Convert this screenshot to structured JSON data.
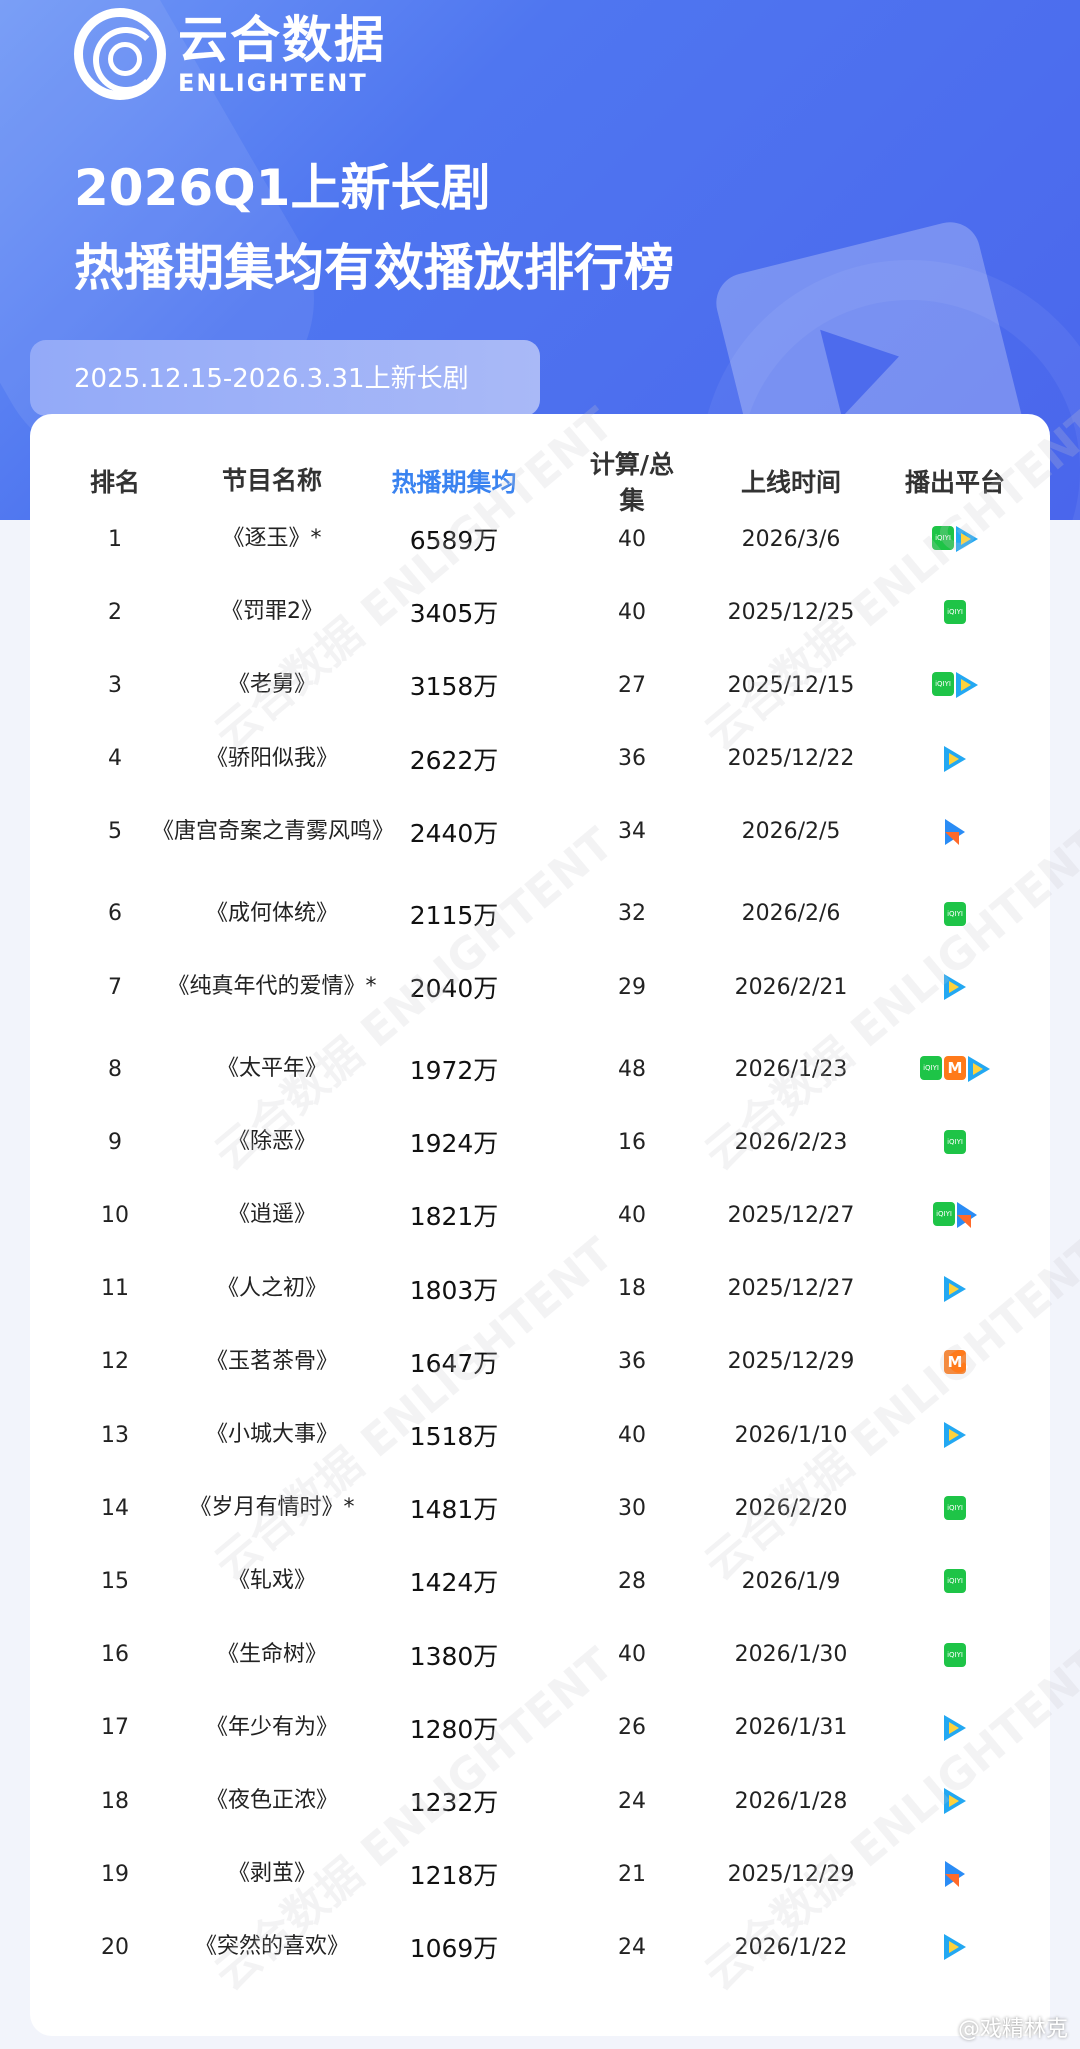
{
  "logo": {
    "cn": "云合数据",
    "en": "ENLIGHTENT"
  },
  "title": {
    "line1": "2026Q1上新长剧",
    "line2": "热播期集均有效播放排行榜"
  },
  "subtitle": "2025.12.15-2026.3.31上新长剧",
  "watermark": "云合数据 ENLIGHTENT",
  "headers": {
    "rank": "排名",
    "name": "节目名称",
    "value": "热播期集均",
    "episodes": "计算/总集",
    "date": "上线时间",
    "platform": "播出平台"
  },
  "colors": {
    "accent": "#3a83f0",
    "iqiyi": "#1ec447",
    "tencent": "#23a8f2",
    "youku": "#2a8cf5",
    "mango": "#ff7a1a"
  },
  "rows": [
    {
      "rank": "1",
      "name": "《逐玉》*",
      "value": "6589万",
      "episodes": "40",
      "date": "2026/3/6",
      "platforms": [
        "iqiyi",
        "tencent"
      ]
    },
    {
      "rank": "2",
      "name": "《罚罪2》",
      "value": "3405万",
      "episodes": "40",
      "date": "2025/12/25",
      "platforms": [
        "iqiyi"
      ]
    },
    {
      "rank": "3",
      "name": "《老舅》",
      "value": "3158万",
      "episodes": "27",
      "date": "2025/12/15",
      "platforms": [
        "iqiyi",
        "tencent"
      ]
    },
    {
      "rank": "4",
      "name": "《骄阳似我》",
      "value": "2622万",
      "episodes": "36",
      "date": "2025/12/22",
      "platforms": [
        "tencent"
      ]
    },
    {
      "rank": "5",
      "name": "《唐宫奇案之青雾风鸣》",
      "value": "2440万",
      "episodes": "34",
      "date": "2026/2/5",
      "platforms": [
        "youku"
      ]
    },
    {
      "rank": "6",
      "name": "《成何体统》",
      "value": "2115万",
      "episodes": "32",
      "date": "2026/2/6",
      "platforms": [
        "iqiyi"
      ]
    },
    {
      "rank": "7",
      "name": "《纯真年代的爱情》*",
      "value": "2040万",
      "episodes": "29",
      "date": "2026/2/21",
      "platforms": [
        "tencent"
      ]
    },
    {
      "rank": "8",
      "name": "《太平年》",
      "value": "1972万",
      "episodes": "48",
      "date": "2026/1/23",
      "platforms": [
        "iqiyi",
        "mango",
        "tencent"
      ]
    },
    {
      "rank": "9",
      "name": "《除恶》",
      "value": "1924万",
      "episodes": "16",
      "date": "2026/2/23",
      "platforms": [
        "iqiyi"
      ]
    },
    {
      "rank": "10",
      "name": "《逍遥》",
      "value": "1821万",
      "episodes": "40",
      "date": "2025/12/27",
      "platforms": [
        "iqiyi",
        "youku"
      ]
    },
    {
      "rank": "11",
      "name": "《人之初》",
      "value": "1803万",
      "episodes": "18",
      "date": "2025/12/27",
      "platforms": [
        "tencent"
      ]
    },
    {
      "rank": "12",
      "name": "《玉茗茶骨》",
      "value": "1647万",
      "episodes": "36",
      "date": "2025/12/29",
      "platforms": [
        "mango"
      ]
    },
    {
      "rank": "13",
      "name": "《小城大事》",
      "value": "1518万",
      "episodes": "40",
      "date": "2026/1/10",
      "platforms": [
        "tencent"
      ]
    },
    {
      "rank": "14",
      "name": "《岁月有情时》*",
      "value": "1481万",
      "episodes": "30",
      "date": "2026/2/20",
      "platforms": [
        "iqiyi"
      ]
    },
    {
      "rank": "15",
      "name": "《轧戏》",
      "value": "1424万",
      "episodes": "28",
      "date": "2026/1/9",
      "platforms": [
        "iqiyi"
      ]
    },
    {
      "rank": "16",
      "name": "《生命树》",
      "value": "1380万",
      "episodes": "40",
      "date": "2026/1/30",
      "platforms": [
        "iqiyi"
      ]
    },
    {
      "rank": "17",
      "name": "《年少有为》",
      "value": "1280万",
      "episodes": "26",
      "date": "2026/1/31",
      "platforms": [
        "tencent"
      ]
    },
    {
      "rank": "18",
      "name": "《夜色正浓》",
      "value": "1232万",
      "episodes": "24",
      "date": "2026/1/28",
      "platforms": [
        "tencent"
      ]
    },
    {
      "rank": "19",
      "name": "《剥茧》",
      "value": "1218万",
      "episodes": "21",
      "date": "2025/12/29",
      "platforms": [
        "youku"
      ]
    },
    {
      "rank": "20",
      "name": "《突然的喜欢》",
      "value": "1069万",
      "episodes": "24",
      "date": "2026/1/22",
      "platforms": [
        "tencent"
      ]
    }
  ],
  "footer": "@戏精林克"
}
